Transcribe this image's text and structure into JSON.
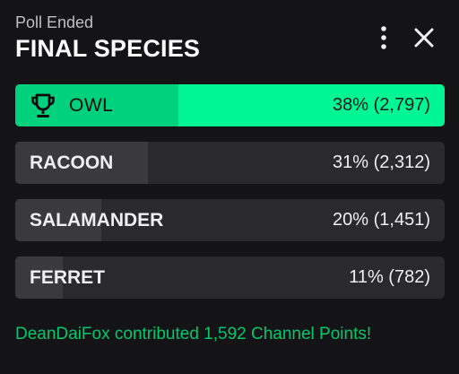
{
  "poll": {
    "status": "Poll Ended",
    "title": "FINAL SPECIES",
    "options": [
      {
        "label": "OWL",
        "percent": 38,
        "result": "38% (2,797)",
        "winner": true
      },
      {
        "label": "RACOON",
        "percent": 31,
        "result": "31% (2,312)",
        "winner": false
      },
      {
        "label": "SALAMANDER",
        "percent": 20,
        "result": "20% (1,451)",
        "winner": false
      },
      {
        "label": "FERRET",
        "percent": 11,
        "result": "11% (782)",
        "winner": false
      }
    ],
    "footer": "DeanDaiFox contributed 1,592 Channel Points!"
  },
  "icons": {
    "more": "more-vertical-icon",
    "close": "close-icon",
    "trophy": "trophy-icon"
  },
  "colors": {
    "winner_bg": "#00f593",
    "winner_fill": "#00d17c",
    "footer_text": "#00c86f"
  }
}
